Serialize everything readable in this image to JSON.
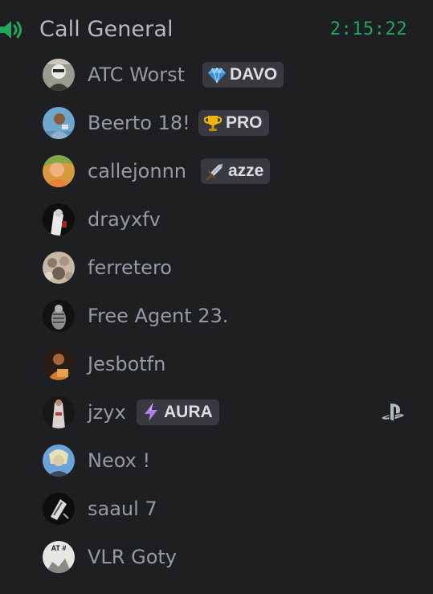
{
  "channel": {
    "icon": "speaker-icon",
    "name": "Call General",
    "timer": "2:15:22",
    "timer_color": "#23a55a"
  },
  "members": [
    {
      "name": "ATC Worst",
      "tag": {
        "icon": "gem-icon",
        "text": "DAVO"
      }
    },
    {
      "name": "Beerto 18!",
      "tag": {
        "icon": "trophy-icon",
        "text": "PRO"
      }
    },
    {
      "name": "callejonnn",
      "tag": {
        "icon": "sword-icon",
        "text": "azze"
      }
    },
    {
      "name": "drayxfv"
    },
    {
      "name": "ferretero"
    },
    {
      "name": "Free Agent 23."
    },
    {
      "name": "Jesbotfn"
    },
    {
      "name": "jzyx",
      "tag": {
        "icon": "lightning-icon",
        "text": "AURA"
      },
      "platform_icon": "playstation-icon"
    },
    {
      "name": "Neox !"
    },
    {
      "name": "saaul 7"
    },
    {
      "name": "VLR Goty",
      "avatar_text": "AT #"
    }
  ]
}
